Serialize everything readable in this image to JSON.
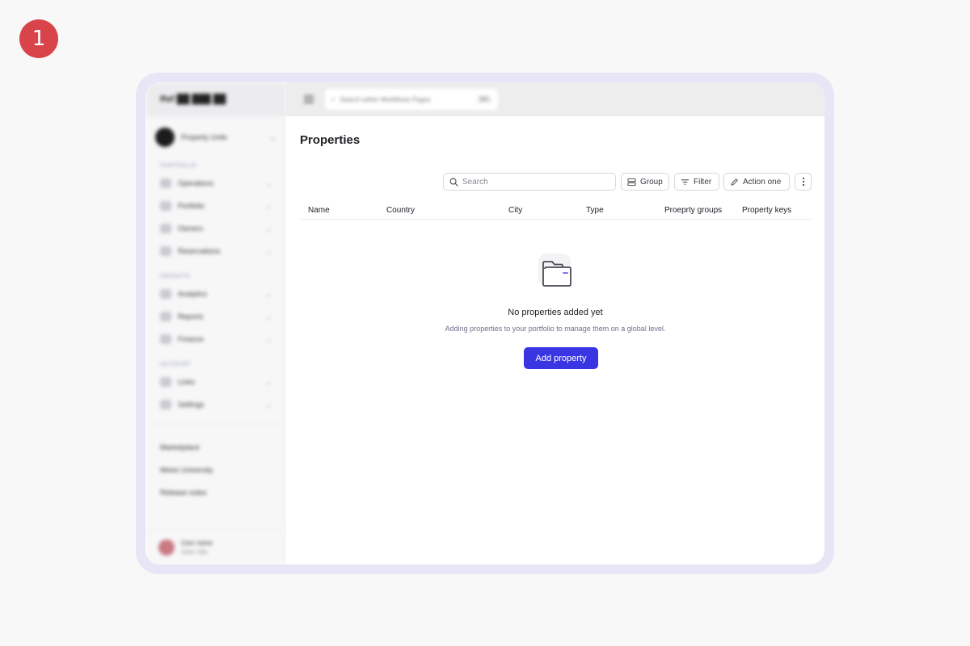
{
  "step": {
    "number": "1"
  },
  "colors": {
    "accent": "#3a35e3",
    "badge": "#d9434a",
    "frame": "#e8e6f6"
  },
  "sidebar": {
    "brand": "Ref ██ ███ ██",
    "account": "Property Units",
    "sections": [
      {
        "title": "PORTFOLIO",
        "items": [
          {
            "label": "Operations",
            "icon": "grid-icon"
          },
          {
            "label": "Portfolio",
            "icon": "building-icon"
          },
          {
            "label": "Owners",
            "icon": "user-icon"
          },
          {
            "label": "Reservations",
            "icon": "calendar-icon"
          }
        ]
      },
      {
        "title": "INSIGHTS",
        "items": [
          {
            "label": "Analytics",
            "icon": "chart-icon"
          },
          {
            "label": "Reports",
            "icon": "person-icon"
          },
          {
            "label": "Finance",
            "icon": "finance-icon"
          }
        ]
      },
      {
        "title": "ACCOUNT",
        "items": [
          {
            "label": "Links",
            "icon": "link-icon"
          },
          {
            "label": "Settings",
            "icon": "gear-icon"
          }
        ]
      }
    ],
    "links": [
      "Marketplace",
      "Mews University",
      "Release notes"
    ],
    "user": {
      "name": "User name",
      "sub": "User role"
    }
  },
  "topbar": {
    "search_placeholder": "Search within Workflows Pages",
    "shortcut": "⌘K"
  },
  "main": {
    "title": "Properties",
    "search_placeholder": "Search",
    "group_label": "Group",
    "filter_label": "Filter",
    "action_label": "Action one",
    "columns": [
      "Name",
      "Country",
      "City",
      "Type",
      "Proeprty groups",
      "Property keys"
    ],
    "empty_title": "No properties added yet",
    "empty_desc": "Adding properties to your portfolio to manage them on a global level.",
    "add_label": "Add property"
  }
}
